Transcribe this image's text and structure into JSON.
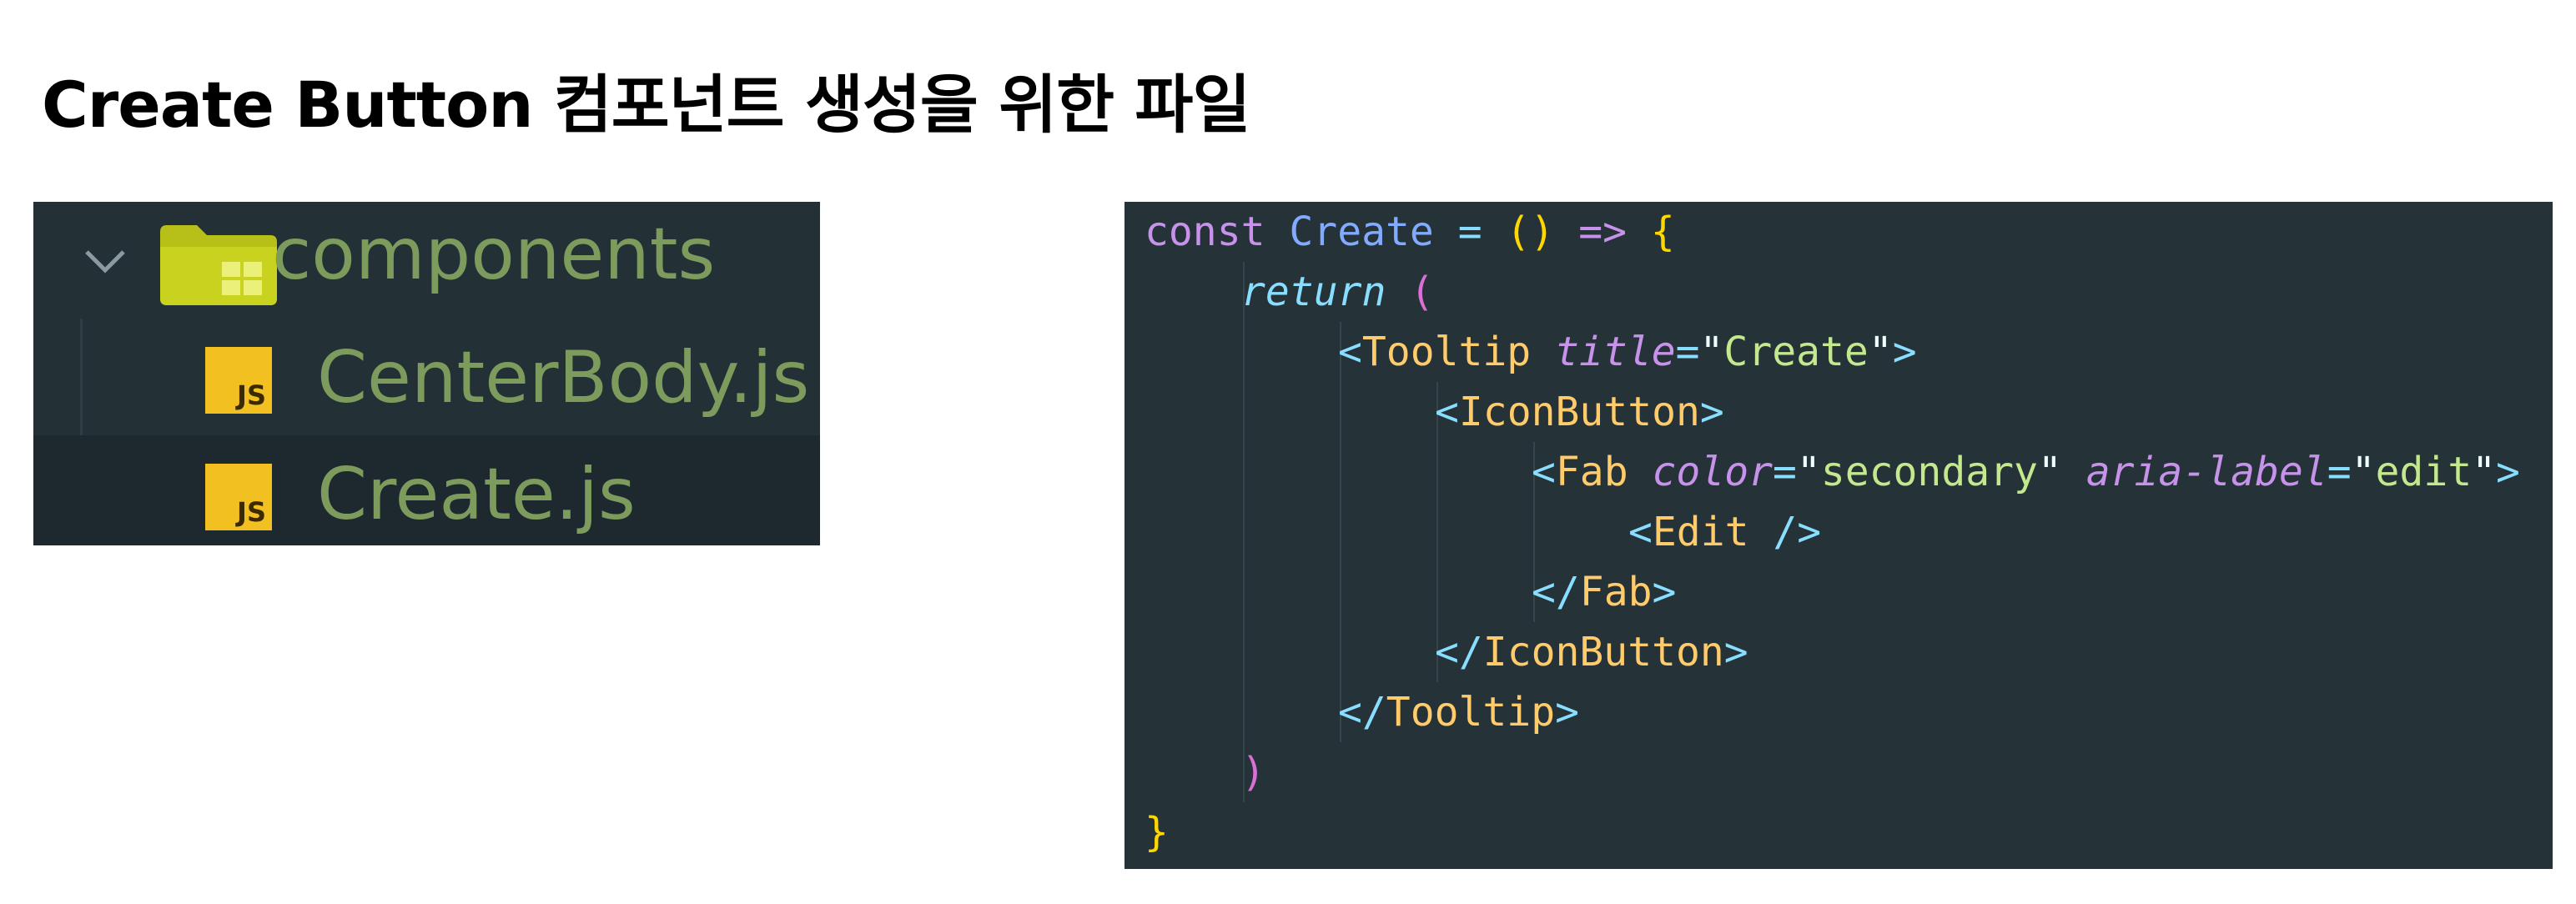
{
  "page": {
    "title": "Create Button 컴포넌트 생성을 위한 파일"
  },
  "explorer": {
    "folder": {
      "label": "components",
      "icon": "folder-components-icon",
      "expanded": true
    },
    "files": [
      {
        "label": "CenterBody.js",
        "badge": "JS",
        "selected": false
      },
      {
        "label": "Create.js",
        "badge": "JS",
        "selected": true
      }
    ]
  },
  "code": {
    "lines": [
      "const Create = () => {",
      "return (",
      "<Tooltip title=\"Create\">",
      "<IconButton>",
      "<Fab color=\"secondary\" aria-label=\"edit\">",
      "<Edit />",
      "</Fab>",
      "</IconButton>",
      "</Tooltip>",
      ")",
      "}"
    ],
    "tokens": {
      "const": "const",
      "name": "Create",
      "eq": "=",
      "parens": "()",
      "arrow": "=>",
      "brace_open": "{",
      "return": "return",
      "paren_open": "(",
      "tooltip": "Tooltip",
      "title_attr": "title",
      "title_val": "Create",
      "iconbutton": "IconButton",
      "fab": "Fab",
      "color_attr": "color",
      "color_val": "secondary",
      "aria_attr": "aria-label",
      "aria_val": "edit",
      "edit": "Edit",
      "paren_close": ")",
      "brace_close": "}"
    }
  },
  "colors": {
    "explorer_bg": "#233036",
    "code_bg": "#253238",
    "file_label": "#7d9b5c",
    "js_badge": "#f2c020",
    "keyword": "#c792ea",
    "function": "#82aaff",
    "tag": "#ffcb6b",
    "string": "#c3e88d",
    "punctuation": "#89ddff"
  }
}
